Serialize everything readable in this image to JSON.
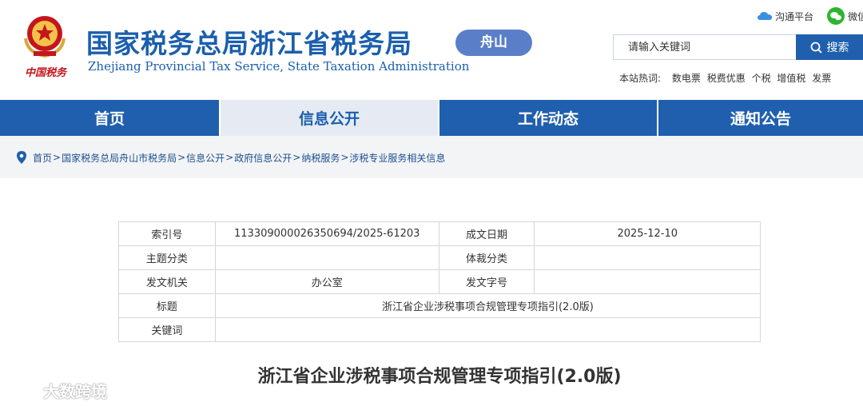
{
  "header": {
    "title_cn": "国家税务总局浙江省税务局",
    "title_en": "Zhejiang Provincial Tax Service, State Taxation Administration",
    "emblem_text": "中国税务",
    "emblem_icon": "tax-emblem-icon",
    "city_badge": "舟山",
    "links": [
      {
        "label": "沟通平台",
        "icon": "cloud-icon"
      },
      {
        "label": "微信",
        "icon": "wechat-icon"
      }
    ],
    "search": {
      "placeholder": "请输入关键词",
      "button_label": "搜索",
      "icon": "search-icon"
    },
    "hot_words_label": "本站热词:",
    "hot_words": [
      "数电票",
      "税费优惠",
      "个税",
      "增值税",
      "发票"
    ]
  },
  "nav": {
    "items": [
      {
        "label": "首页",
        "active": false
      },
      {
        "label": "信息公开",
        "active": true
      },
      {
        "label": "工作动态",
        "active": false
      },
      {
        "label": "通知公告",
        "active": false
      }
    ]
  },
  "breadcrumb": {
    "icon": "location-pin-icon",
    "items": [
      "首页",
      "国家税务总局舟山市税务局",
      "信息公开",
      "政府信息公开",
      "纳税服务",
      "涉税专业服务相关信息"
    ]
  },
  "meta": {
    "rows": [
      {
        "k1": "索引号",
        "v1": "113309000026350694/2025-61203",
        "k2": "成文日期",
        "v2": "2025-12-10"
      },
      {
        "k1": "主题分类",
        "v1": "",
        "k2": "体裁分类",
        "v2": ""
      },
      {
        "k1": "发文机关",
        "v1": "办公室",
        "k2": "发文字号",
        "v2": ""
      }
    ],
    "title_label": "标题",
    "title_value": "浙江省企业涉税事项合规管理专项指引(2.0版)",
    "keywords_label": "关键词",
    "keywords_value": ""
  },
  "document": {
    "title": "浙江省企业涉税事项合规管理专项指引(2.0版)"
  },
  "watermark": {
    "text": "大数跨境"
  },
  "colors": {
    "primary": "#1f5fae",
    "badge": "#5a7fc8",
    "active_nav_bg": "#e6ebf3",
    "wechat_green": "#2db52e",
    "emblem_red": "#c4161c"
  }
}
